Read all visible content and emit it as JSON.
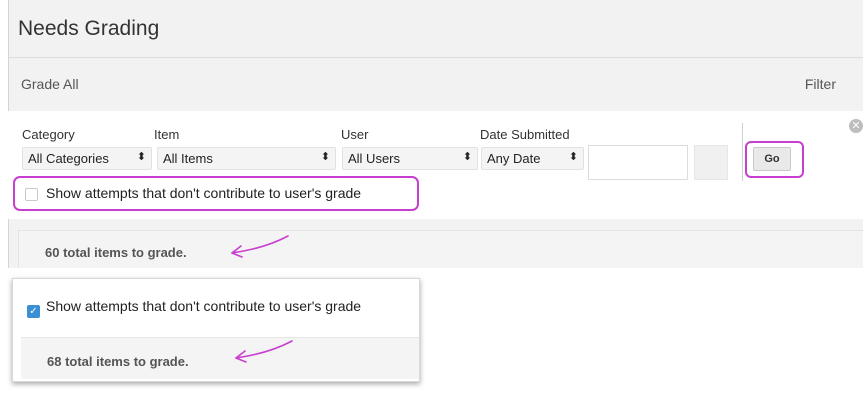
{
  "page": {
    "title": "Needs Grading"
  },
  "header": {
    "grade_all": "Grade All",
    "filter": "Filter"
  },
  "filters": {
    "category": {
      "label": "Category",
      "value": "All Categories"
    },
    "item": {
      "label": "Item",
      "value": "All Items"
    },
    "user": {
      "label": "User",
      "value": "All Users"
    },
    "date_submitted": {
      "label": "Date Submitted",
      "value": "Any Date",
      "input_value": ""
    },
    "go_label": "Go"
  },
  "show_attempts": {
    "label": "Show attempts that don't contribute to user's grade",
    "checked": false
  },
  "summary": {
    "total_text": "60 total items to grade."
  },
  "inset": {
    "show_attempts": {
      "label": "Show attempts that don't contribute to user's grade",
      "checked": true
    },
    "total_text": "68 total items to grade."
  },
  "colors": {
    "highlight": "#c83fd0",
    "arrow": "#c83fd0",
    "checkbox_checked": "#3b8fd4"
  },
  "icons": {
    "close": "close-circle-icon",
    "dropdown": "updown-caret-icon",
    "arrow": "hand-drawn-arrow-icon",
    "check": "checkmark-icon"
  }
}
